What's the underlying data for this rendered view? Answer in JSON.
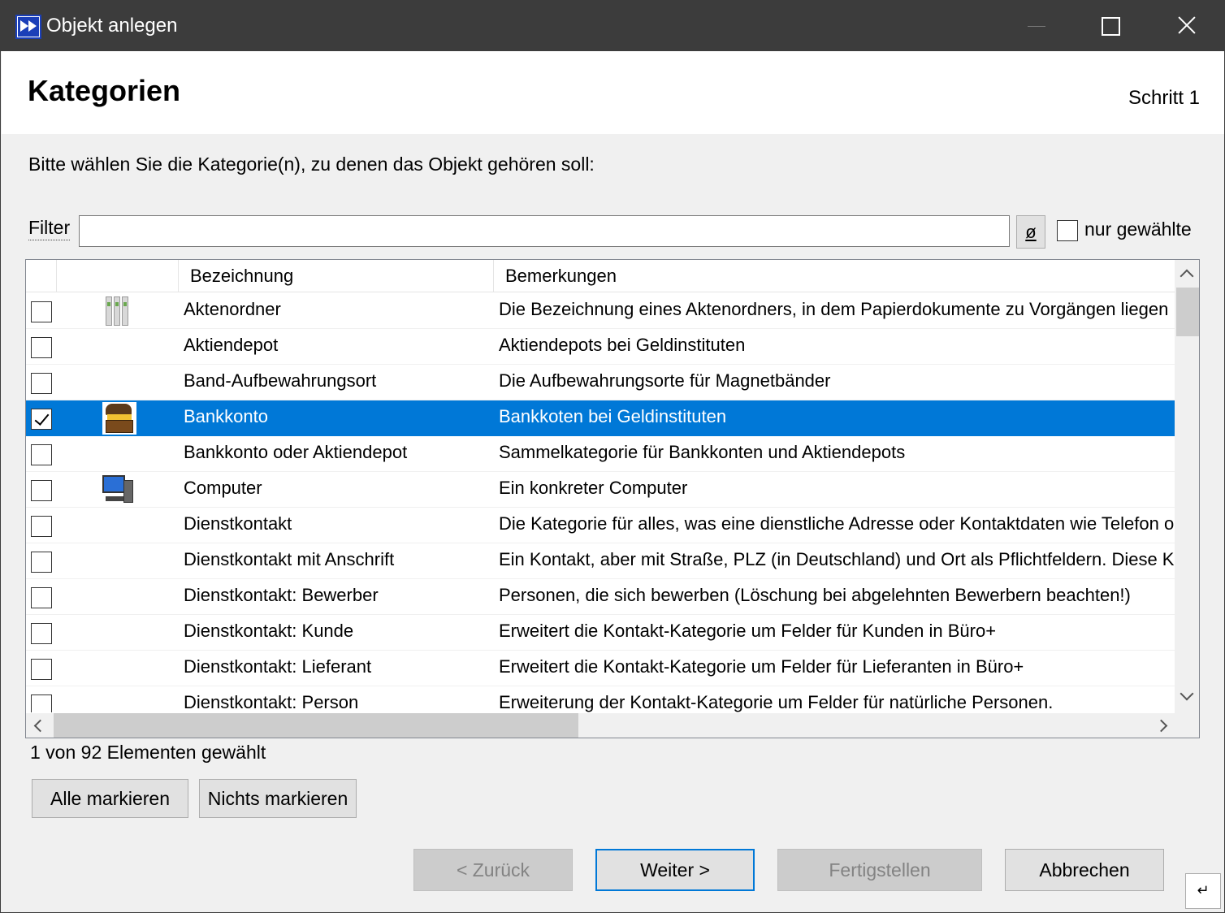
{
  "window": {
    "title": "Objekt anlegen"
  },
  "header": {
    "title": "Kategorien",
    "step": "Schritt 1"
  },
  "instruction": "Bitte wählen Sie die Kategorie(n), zu denen das Objekt gehören soll:",
  "filter": {
    "label": "Filter",
    "value": "",
    "clear_label": "ø",
    "only_selected_label": "nur gewählte",
    "only_selected_checked": false
  },
  "table": {
    "columns": [
      "",
      "",
      "Bezeichnung",
      "Bemerkungen"
    ],
    "rows": [
      {
        "checked": false,
        "icon": "folder-icon",
        "name": "Aktenordner",
        "remark": "Die Bezeichnung eines Aktenordners, in dem Papierdokumente zu Vorgängen liegen",
        "selected": false
      },
      {
        "checked": false,
        "icon": "",
        "name": "Aktiendepot",
        "remark": "Aktiendepots bei Geldinstituten",
        "selected": false
      },
      {
        "checked": false,
        "icon": "",
        "name": "Band-Aufbewahrungsort",
        "remark": "Die Aufbewahrungsorte für Magnetbänder",
        "selected": false
      },
      {
        "checked": true,
        "icon": "treasure-chest-icon",
        "name": "Bankkonto",
        "remark": "Bankkoten bei Geldinstituten",
        "selected": true
      },
      {
        "checked": false,
        "icon": "",
        "name": "Bankkonto oder Aktiendepot",
        "remark": "Sammelkategorie für Bankkonten und Aktiendepots",
        "selected": false
      },
      {
        "checked": false,
        "icon": "computer-icon",
        "name": "Computer",
        "remark": "Ein konkreter Computer",
        "selected": false
      },
      {
        "checked": false,
        "icon": "",
        "name": "Dienstkontakt",
        "remark": "Die Kategorie für alles, was eine dienstliche Adresse oder Kontaktdaten wie Telefon ode",
        "selected": false
      },
      {
        "checked": false,
        "icon": "",
        "name": "Dienstkontakt mit Anschrift",
        "remark": "Ein Kontakt, aber mit Straße, PLZ (in Deutschland) und Ort als Pflichtfeldern. Diese Kate",
        "selected": false
      },
      {
        "checked": false,
        "icon": "",
        "name": "Dienstkontakt: Bewerber",
        "remark": "Personen, die sich bewerben (Löschung bei abgelehnten Bewerbern beachten!)",
        "selected": false
      },
      {
        "checked": false,
        "icon": "",
        "name": "Dienstkontakt: Kunde",
        "remark": "Erweitert die Kontakt-Kategorie um Felder für Kunden in Büro+",
        "selected": false
      },
      {
        "checked": false,
        "icon": "",
        "name": "Dienstkontakt: Lieferant",
        "remark": "Erweitert die Kontakt-Kategorie um Felder für Lieferanten in Büro+",
        "selected": false
      },
      {
        "checked": false,
        "icon": "",
        "name": "Dienstkontakt: Person",
        "remark": "Erweiterung der Kontakt-Kategorie um Felder für natürliche Personen.",
        "selected": false
      }
    ]
  },
  "status": "1 von 92 Elementen gewählt",
  "buttons": {
    "select_all": "Alle markieren",
    "select_none": "Nichts markieren",
    "back": "< Zurück",
    "next": "Weiter >",
    "finish": "Fertigstellen",
    "cancel": "Abbrechen"
  }
}
